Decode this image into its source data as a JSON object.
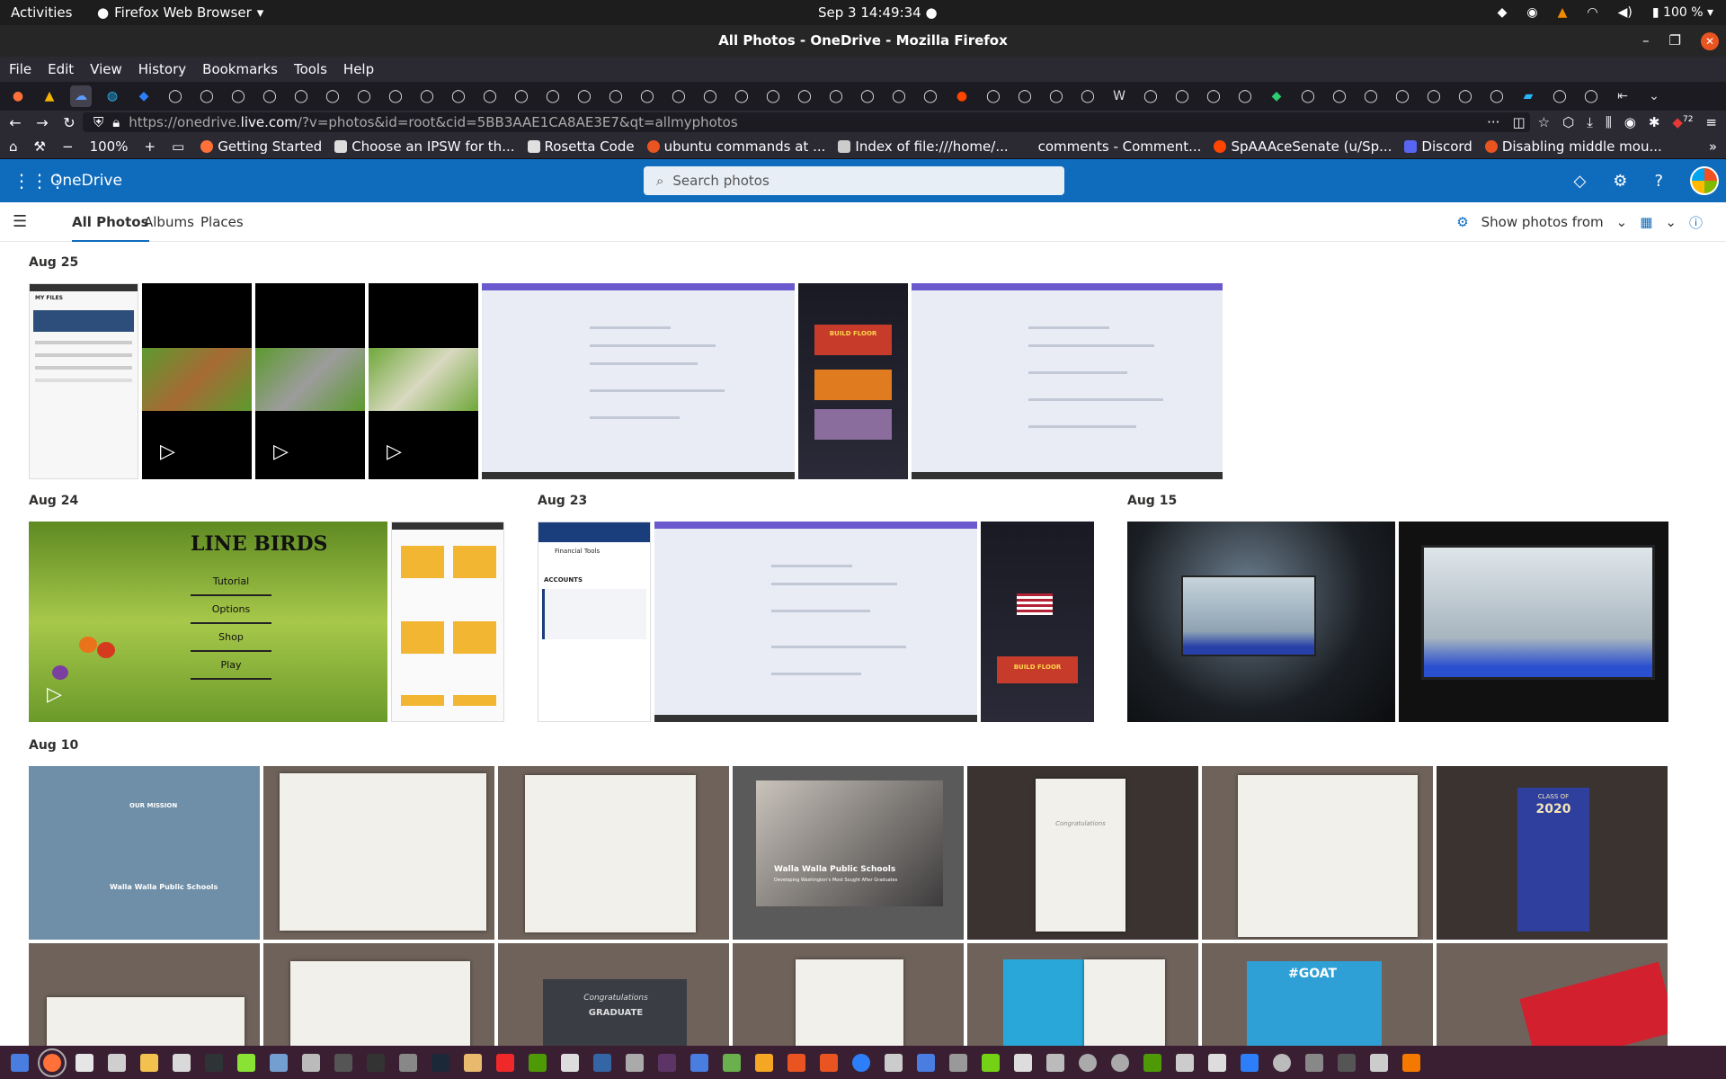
{
  "system_bar": {
    "activities": "Activities",
    "app_name": "Firefox Web Browser",
    "clock": "Sep 3  14:49:34",
    "battery": "100 %"
  },
  "window": {
    "title": "All Photos - OneDrive - Mozilla Firefox"
  },
  "menu": [
    "File",
    "Edit",
    "View",
    "History",
    "Bookmarks",
    "Tools",
    "Help"
  ],
  "navigation": {
    "url_prefix": "https://onedrive.",
    "url_domain": "live.com",
    "url_rest": "/?v=photos&id=root&cid=5BB3AAE1CA8AE3E7&qt=allmyphotos",
    "zoom": "100%",
    "notification_count": "72"
  },
  "bookmarks": [
    "Getting Started",
    "Choose an IPSW for th...",
    "Rosetta Code",
    "ubuntu commands at ...",
    "Index of file:///home/...",
    "comments - Comment...",
    "SpAAAceSenate (u/Sp...",
    "Discord",
    "Disabling middle mou..."
  ],
  "onedrive": {
    "brand": "OneDrive",
    "search_placeholder": "Search photos",
    "tabs": [
      "All Photos",
      "Albums",
      "Places"
    ],
    "show_photos_from": "Show photos from"
  },
  "groups": {
    "aug25": "Aug 25",
    "aug24": "Aug 24",
    "aug23": "Aug 23",
    "aug15": "Aug 15",
    "aug10": "Aug 10"
  },
  "thumb_text": {
    "my_files": "MY FILES",
    "line_birds": "LINE BIRDS",
    "line_birds_menu": [
      "Tutorial",
      "Options",
      "Shop",
      "Play"
    ],
    "build_floor": "BUILD FLOOR",
    "accounts": "ACCOUNTS",
    "financial_tools": "Financial Tools",
    "school_name": "Walla Walla Public Schools",
    "school_tagline": "Developing Washington's Most Sought After Graduates",
    "mission": "OUR MISSION",
    "class_of": "CLASS OF",
    "class_year": "2020",
    "congrats": "Congratulations",
    "graduate": "GRADUATE",
    "goat": "#GOAT"
  },
  "colors": {
    "onedrive_blue": "#0f6cbd",
    "firefox_purple": "#6a5acd"
  }
}
